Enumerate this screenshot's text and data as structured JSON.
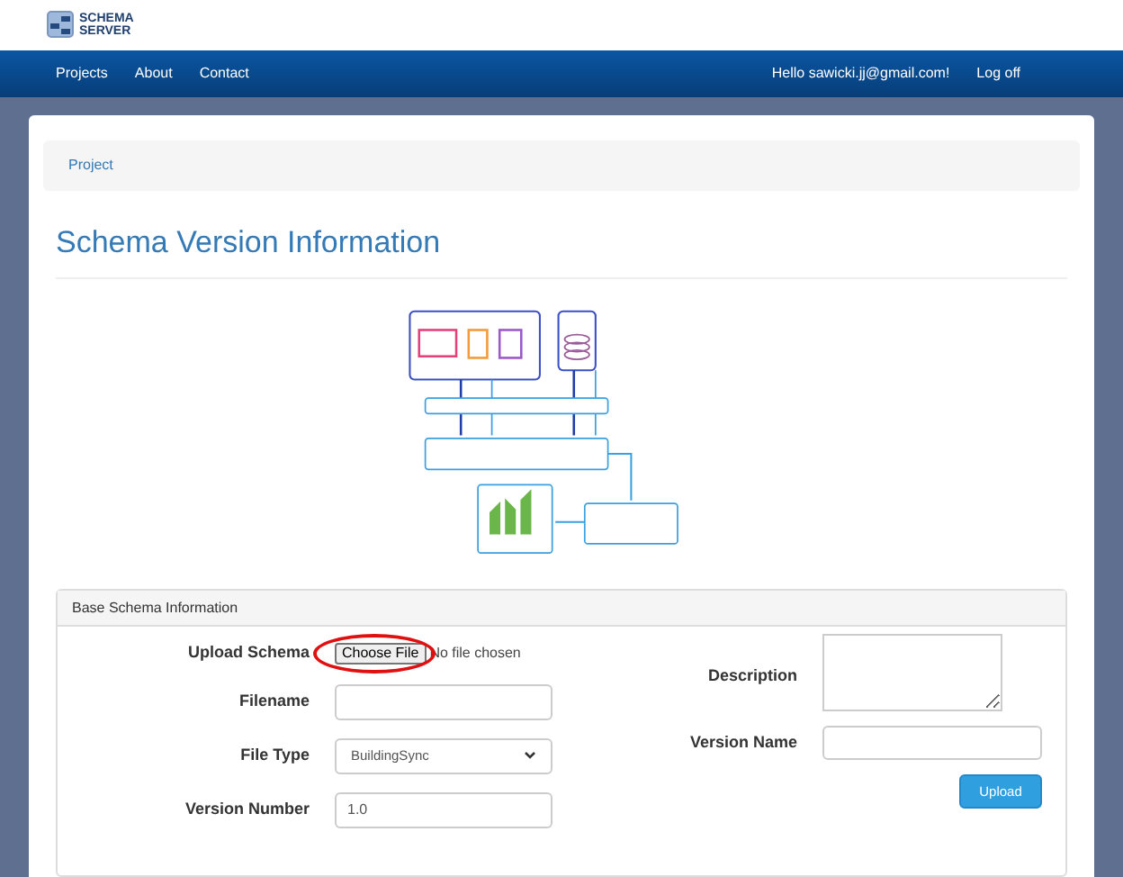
{
  "logo": {
    "line_1": "SCHEMA",
    "line_2": "SERVER"
  },
  "nav": {
    "items": [
      {
        "label": "Projects"
      },
      {
        "label": "About"
      },
      {
        "label": "Contact"
      }
    ],
    "greeting": "Hello sawicki.jj@gmail.com!",
    "logoff": "Log off"
  },
  "breadcrumb": "Project",
  "page_title": "Schema Version Information",
  "panel": {
    "title": "Base Schema Information",
    "upload": {
      "label": "Upload Schema",
      "button": "Choose File",
      "status": "No file chosen",
      "annotated": true
    },
    "filename": {
      "label": "Filename"
    },
    "file_type": {
      "label": "File Type",
      "value": "BuildingSync"
    },
    "version_number": {
      "label": "Version Number",
      "value": "1.0"
    },
    "description": {
      "label": "Description"
    },
    "version_name": {
      "label": "Version Name"
    },
    "submit": "Upload"
  }
}
